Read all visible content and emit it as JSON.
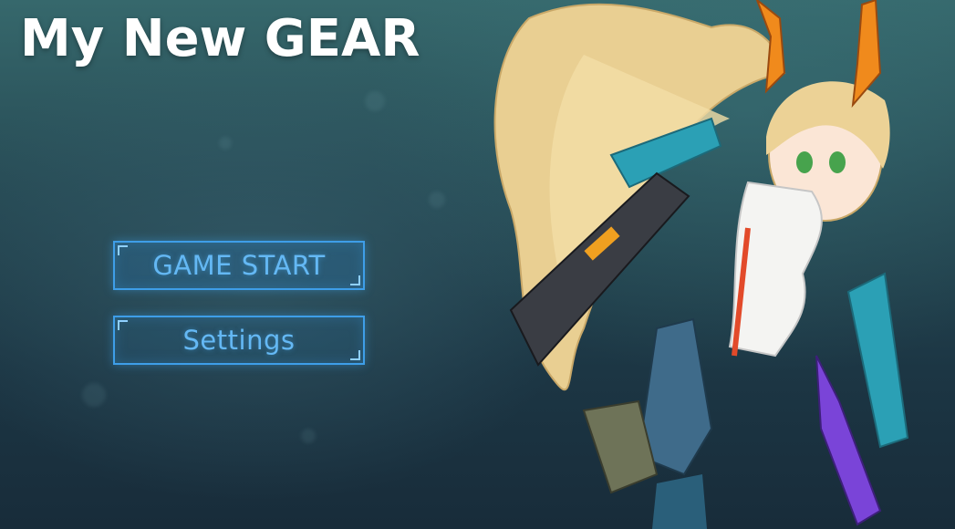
{
  "game": {
    "title": "My New GEAR"
  },
  "menu": {
    "start_label": "GAME START",
    "settings_label": "Settings"
  },
  "colors": {
    "button_border": "#3e9ee8",
    "button_text": "#64b8f4",
    "title_text": "#ffffff",
    "background_top": "#36686c",
    "background_bottom": "#182c3a"
  },
  "artwork": {
    "subject": "anime-mecha-girl-character"
  }
}
